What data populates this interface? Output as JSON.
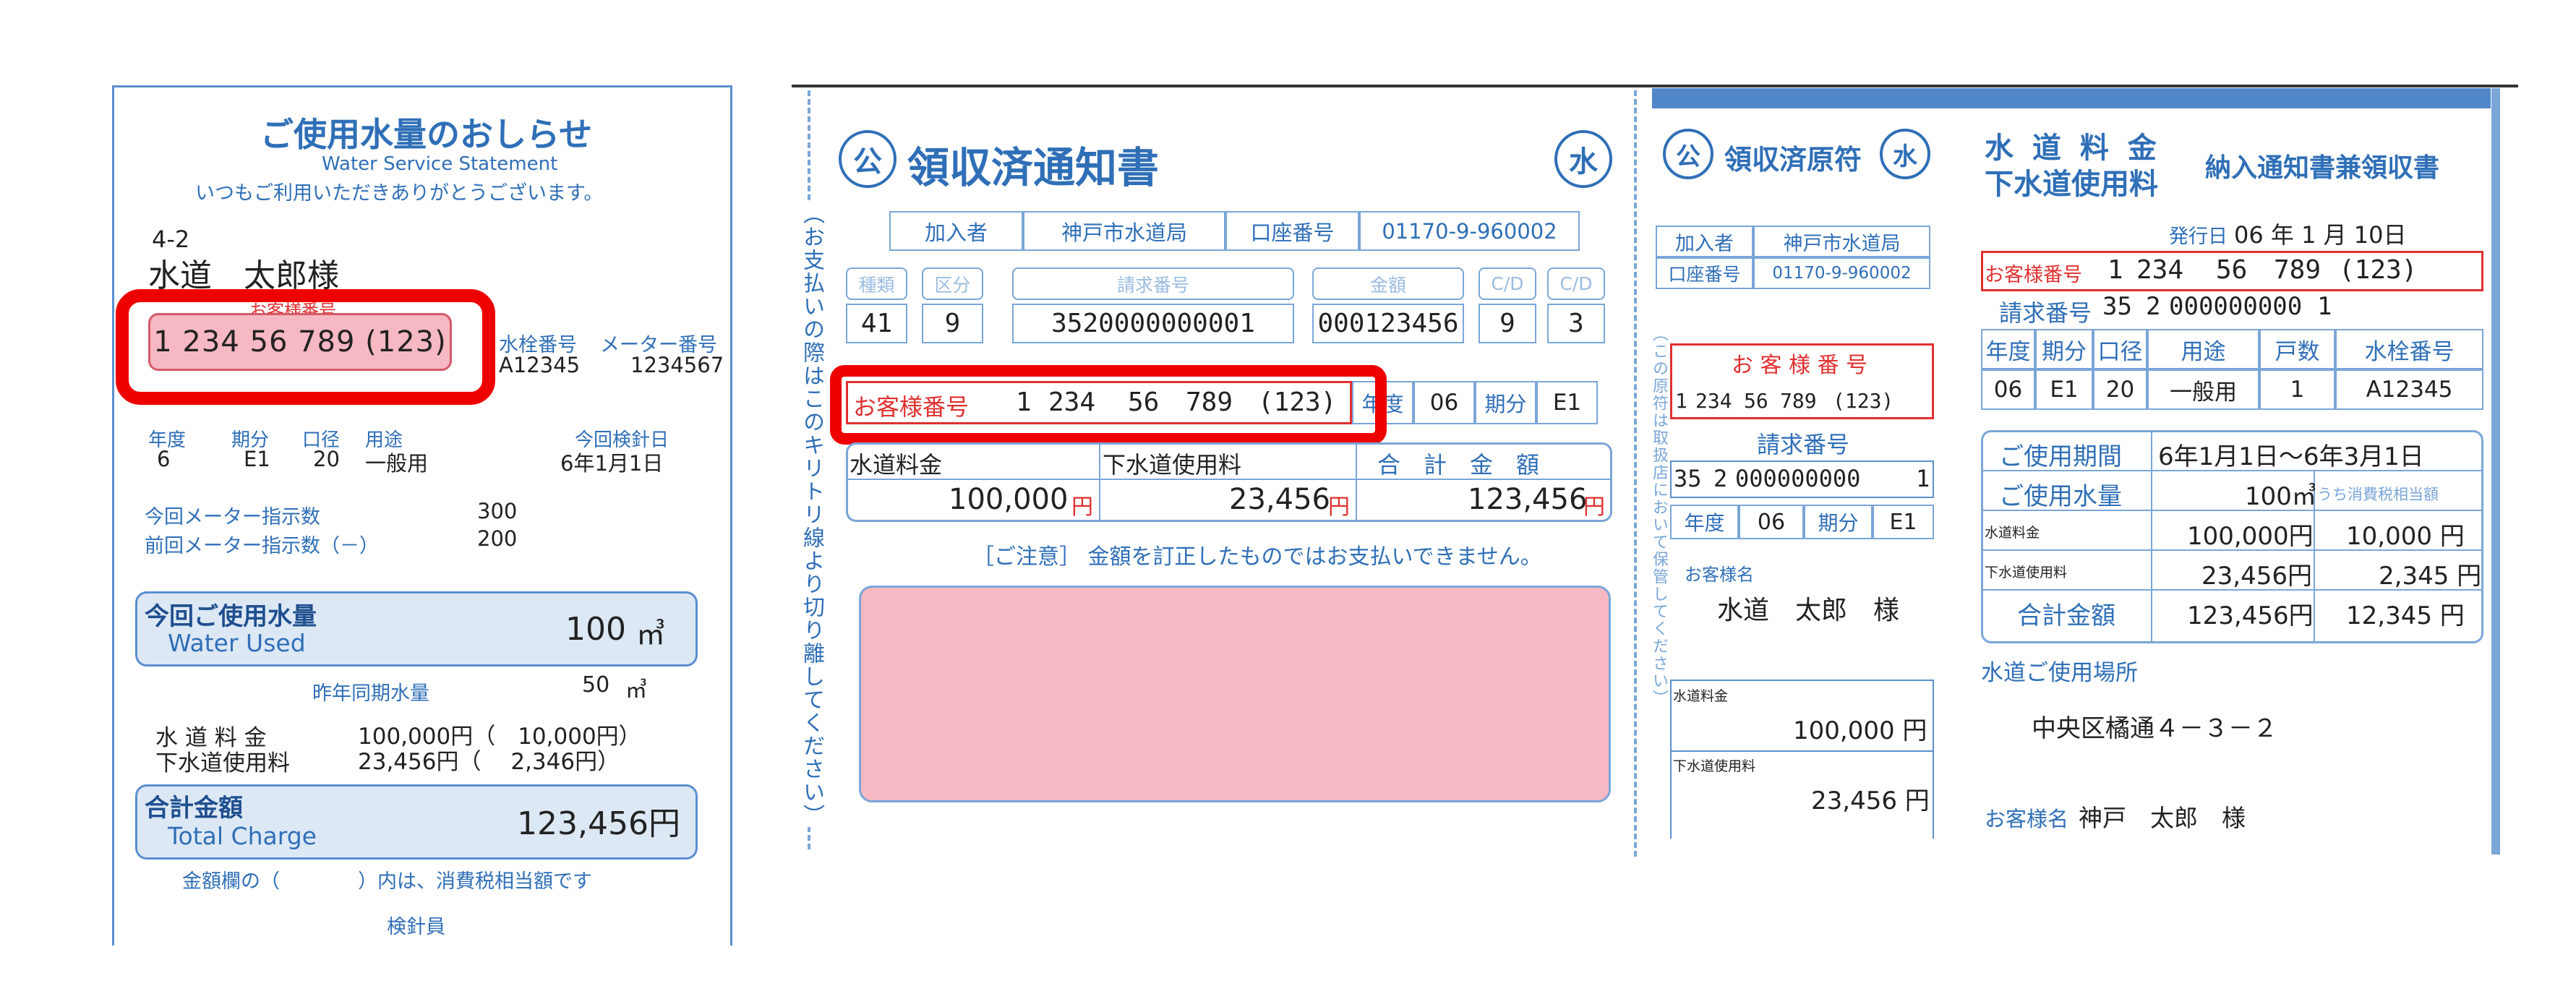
{
  "notice": {
    "title": "ご使用水量のおしらせ",
    "subtitle": "Water Service Statement",
    "greeting": "いつもご利用いただきありがとうございます。",
    "address": "4-2",
    "name": "水道　太郎様",
    "customer_no_label": "お客様番号",
    "customer_no": "1 234 56 789 (123)",
    "meter_no_label": "水栓番号",
    "meter_no": "A12345",
    "meter_id_label": "メーター番号",
    "meter_id": "1234567",
    "year_label": "年度",
    "year": "6",
    "period_label": "期分",
    "period": "E1",
    "bore_label": "口径",
    "bore": "20",
    "use_label": "用途",
    "use": "一般用",
    "inspect_label": "今回検針日",
    "inspect": "6年1月1日",
    "cur_meter_label": "今回メーター指示数",
    "cur_meter": "300",
    "prev_meter_label": "前回メーター指示数（－）",
    "prev_meter": "200",
    "used_label": "今回ご使用水量",
    "used_en": "Water Used",
    "used_value": "100",
    "used_unit": "㎥",
    "lastyear_label": "昨年同期水量",
    "lastyear_value": "50",
    "lastyear_unit": "㎥",
    "water_fee_label": "水 道 料 金",
    "water_fee": "100,000円（　10,000円）",
    "sewer_fee_label": "下水道使用料",
    "sewer_fee": "23,456円（　 2,346円）",
    "total_label": "合計金額",
    "total_en": "Total Charge",
    "total_value": "123,456円",
    "note": "金額欄の（　　　　）内は、消費税相当額です",
    "inspector": "検針員"
  },
  "receipt": {
    "title": "領収済通知書",
    "kou": "公",
    "mizu": "水",
    "member_label": "加入者",
    "member": "神戸市水道局",
    "account_label": "口座番号",
    "account": "01170-9-960002",
    "col_type": "種類",
    "col_kubun": "区分",
    "col_bill": "請求番号",
    "col_amount": "金額",
    "col_cd1": "C/D",
    "col_cd2": "C/D",
    "v_type": "41",
    "v_kubun": "9",
    "v_bill": "3520000000001",
    "v_amount": "000123456",
    "v_cd1": "9",
    "v_cd2": "3",
    "cust_label": "お客様番号",
    "cust_segs": [
      "1",
      "234",
      "56",
      "789",
      "(123)"
    ],
    "year_label": "年度",
    "year": "06",
    "period_label": "期分",
    "period": "E1",
    "water_label": "水道料金",
    "sewer_label": "下水道使用料",
    "total_label": "合　計　金　額",
    "water_value": "100,000",
    "sewer_value": "23,456",
    "total_value": "123,456",
    "yen": "円",
    "caution": "［ご注意］ 金額を訂正したものではお支払いできません。",
    "side_text": "（お支払いの際はこのキリトリ線より切り離してください）"
  },
  "stub": {
    "title": "領収済原符",
    "kou": "公",
    "mizu": "水",
    "member_label": "加入者",
    "member": "神戸市水道局",
    "account_label": "口座番号",
    "account": "01170-9-960002",
    "cust_label": "お 客 様 番 号",
    "cust_segs": [
      "1",
      "234",
      "56",
      "789",
      "(123)"
    ],
    "bill_label": "請求番号",
    "bill_segs": [
      "35",
      "2",
      "000000000",
      "1"
    ],
    "year_label": "年度",
    "year": "06",
    "period_label": "期分",
    "period": "E1",
    "name_label": "お客様名",
    "name": "水道　太郎　様",
    "water_label": "水道料金",
    "water_value": "100,000 円",
    "sewer_label": "下水道使用料",
    "sewer_value": "23,456 円",
    "side_text": "（この原符は取扱店において保管してください）"
  },
  "invoice": {
    "title1": "水 道 料 金",
    "title2": "下水道使用料",
    "title3": "納入通知書兼領収書",
    "issue_label": "発行日",
    "issue": "06 年 1 月 10日",
    "cust_label": "お客様番号",
    "cust_segs": [
      "1",
      "234",
      "56",
      "789",
      "(123)"
    ],
    "bill_label": "請求番号",
    "bill_segs": [
      "35",
      "2",
      "000000000",
      "1"
    ],
    "h_year": "年度",
    "h_period": "期分",
    "h_bore": "口径",
    "h_use": "用途",
    "h_count": "戸数",
    "h_meter": "水栓番号",
    "v_year": "06",
    "v_period": "E1",
    "v_bore": "20",
    "v_use": "一般用",
    "v_count": "1",
    "v_meter": "A12345",
    "period_label": "ご使用期間",
    "period": "6年1月1日～6年3月1日",
    "used_label": "ご使用水量",
    "used": "100㎥",
    "tax_label": "うち消費税相当額",
    "water_label": "水道料金",
    "water": "100,000円",
    "water_tax": "10,000 円",
    "sewer_label": "下水道使用料",
    "sewer": "23,456円",
    "sewer_tax": "2,345 円",
    "total_label": "合計金額",
    "total": "123,456円",
    "total_tax": "12,345 円",
    "place_label": "水道ご使用場所",
    "place": "中央区橘通４－３－２",
    "name_label": "お客様名",
    "name": "神戸　太郎　様"
  }
}
